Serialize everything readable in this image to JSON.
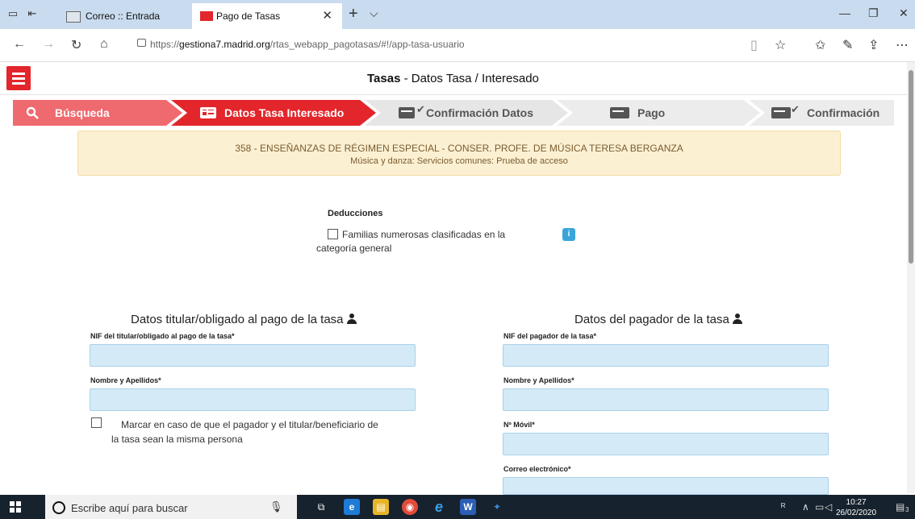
{
  "browser": {
    "tabs": [
      {
        "label": "Correo :: Entrada"
      },
      {
        "label": "Pago de Tasas"
      }
    ],
    "url_prefix": "https://",
    "url_domain": "gestiona7.madrid.org",
    "url_path": "/rtas_webapp_pagotasas/#!/app-tasa-usuario"
  },
  "header": {
    "title_bold": "Tasas",
    "title_rest": " - Datos Tasa / Interesado"
  },
  "steps": [
    {
      "label": "Búsqueda",
      "state": "visited",
      "icon": "search-icon"
    },
    {
      "label": "Datos Tasa Interesado",
      "state": "active",
      "icon": "id-card-icon"
    },
    {
      "label": "Confirmación Datos",
      "state": "pending",
      "icon": "id-card-icon"
    },
    {
      "label": "Pago",
      "state": "pending",
      "icon": "credit-card-icon"
    },
    {
      "label": "Confirmación Pago",
      "state": "pending",
      "icon": "credit-card-icon"
    }
  ],
  "banner": {
    "line1": "358  -  ENSEÑANZAS DE RÉGIMEN ESPECIAL  -  CONSER. PROFE. DE MÚSICA TERESA BERGANZA",
    "line2": "Música y danza: Servicios comunes: Prueba de acceso"
  },
  "deducciones": {
    "title": "Deducciones",
    "option_line1": "Familias numerosas clasificadas en la",
    "option_line2": "categoría general",
    "info_label": "i"
  },
  "titular": {
    "title": "Datos titular/obligado al pago de la tasa",
    "nif_label": "NIF del titular/obligado al pago de la tasa*",
    "nombre_label": "Nombre y Apellidos*",
    "same_line1": "Marcar en caso de que el pagador y el titular/beneficiario de",
    "same_line2": "la tasa sean la misma persona"
  },
  "pagador": {
    "title": "Datos del pagador de la tasa",
    "nif_label": "NIF del pagador de la tasa*",
    "nombre_label": "Nombre y Apellidos*",
    "movil_label": "Nº Móvil*",
    "email_label": "Correo electrónico*"
  },
  "taskbar": {
    "search_placeholder": "Escribe aquí para buscar",
    "time": "10:27",
    "date": "26/02/2020",
    "notification_count": "3"
  }
}
